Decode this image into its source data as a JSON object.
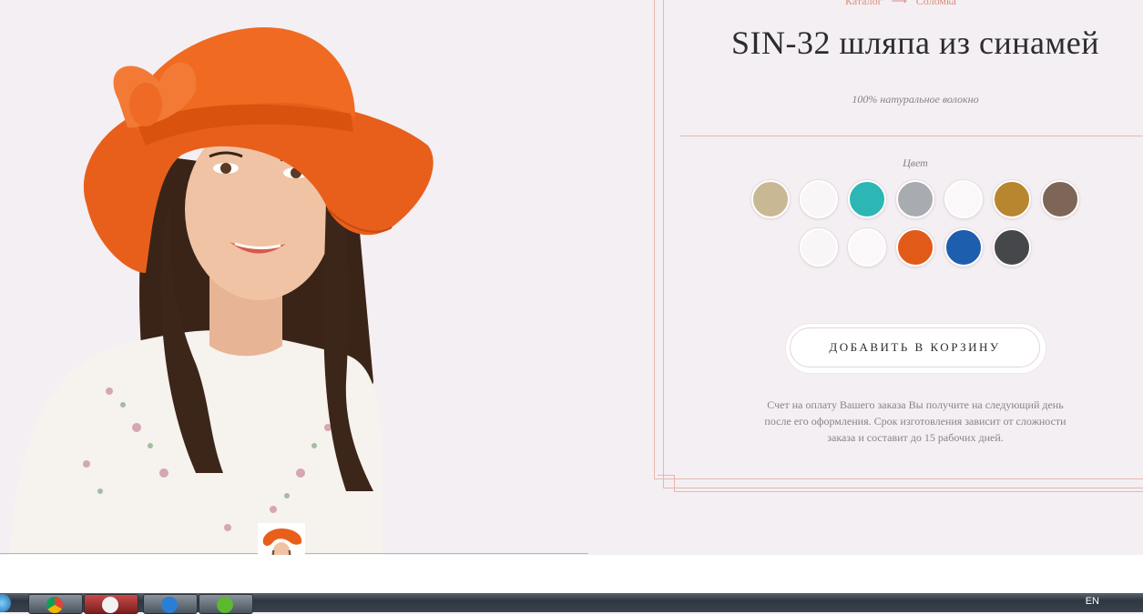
{
  "breadcrumb": {
    "items": [
      "Каталог",
      "Соломка"
    ],
    "separator": "⟶"
  },
  "product": {
    "title": "SIN-32 шляпа из синамей",
    "subtitle": "100% натуральное волокно",
    "color_label": "Цвет",
    "colors": [
      {
        "name": "beige",
        "hex": "#c8b994"
      },
      {
        "name": "white",
        "hex": "#f8f6f7"
      },
      {
        "name": "turquoise",
        "hex": "#2cb7b5"
      },
      {
        "name": "light-gray",
        "hex": "#a8acb0"
      },
      {
        "name": "white",
        "hex": "#faf8f9"
      },
      {
        "name": "mustard",
        "hex": "#b8862e"
      },
      {
        "name": "brown",
        "hex": "#7d6558"
      },
      {
        "name": "white",
        "hex": "#f8f6f7"
      },
      {
        "name": "white",
        "hex": "#faf8f9"
      },
      {
        "name": "orange",
        "hex": "#e25a18"
      },
      {
        "name": "royal-blue",
        "hex": "#1d5fae"
      },
      {
        "name": "dark-gray",
        "hex": "#45474a"
      }
    ],
    "add_to_cart": "ДОБАВИТЬ В КОРЗИНУ",
    "note": "Счет на оплату Вашего заказа Вы получите на следующий день после его оформления. Срок изготовления зависит от сложности заказа и составит до 15 рабочих дней."
  },
  "taskbar": {
    "apps": [
      "start-orb",
      "chrome",
      "app-red",
      "internet-explorer",
      "utorrent"
    ],
    "language": "EN"
  },
  "colors": {
    "accent": "#d9917d",
    "background": "#f4eff3",
    "text": "#2c2c2c",
    "muted": "#8a8285"
  }
}
